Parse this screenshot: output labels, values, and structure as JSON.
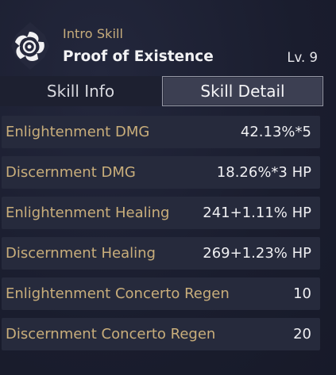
{
  "header": {
    "skill_type": "Intro Skill",
    "skill_name": "Proof of Existence",
    "level": "Lv. 9",
    "emblem_icon": "swirl-skill-emblem-icon"
  },
  "tabs": [
    {
      "label": "Skill Info",
      "selected": false
    },
    {
      "label": "Skill Detail",
      "selected": true
    }
  ],
  "stats": [
    {
      "label": "Enlightenment DMG",
      "value": "42.13%*5"
    },
    {
      "label": "Discernment DMG",
      "value": "18.26%*3 HP"
    },
    {
      "label": "Enlightenment Healing",
      "value": "241+1.11% HP"
    },
    {
      "label": "Discernment Healing",
      "value": "269+1.23% HP"
    },
    {
      "label": "Enlightenment Concerto Regen",
      "value": "10"
    },
    {
      "label": "Discernment Concerto Regen",
      "value": "20"
    }
  ],
  "colors": {
    "label_gold": "#c9ae7b",
    "value_white": "#efeff2",
    "row_bg": "#262a3c",
    "background": "#1a1d2e"
  }
}
